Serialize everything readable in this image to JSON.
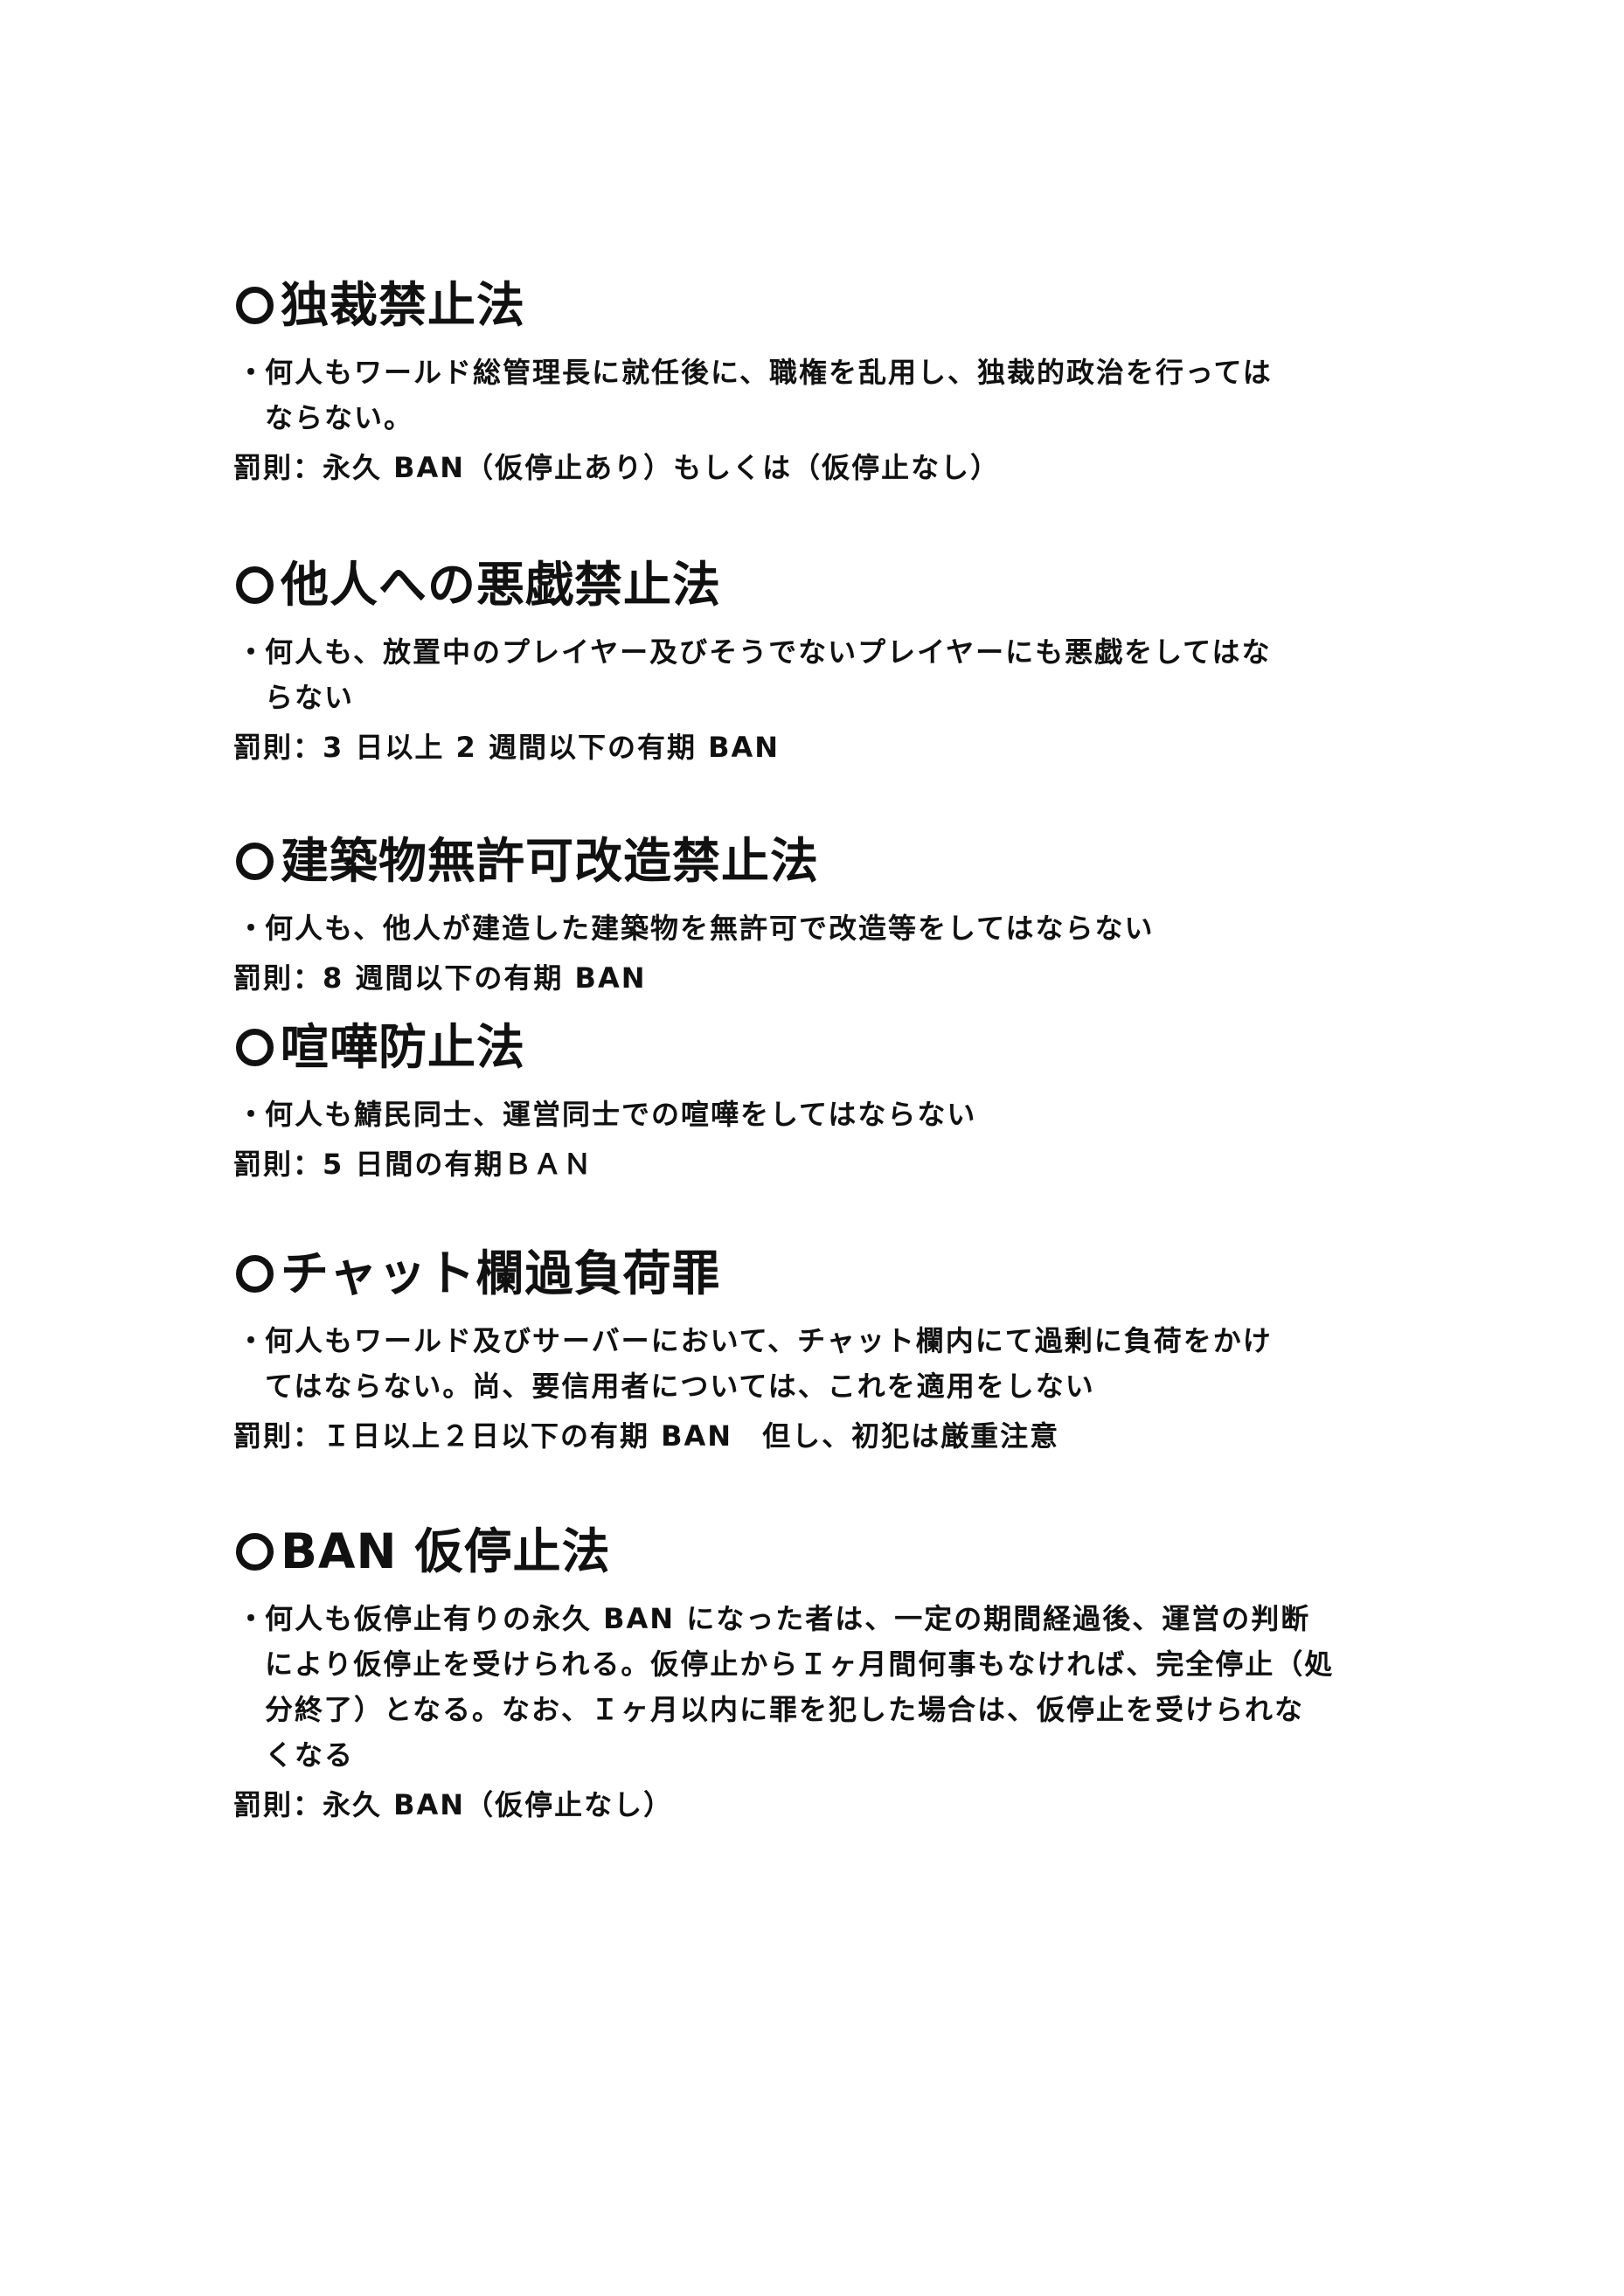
{
  "sections": [
    {
      "title": "独裁禁止法",
      "bullet": "・",
      "lines": [
        "何人もワールド総管理長に就任後に、職権を乱用し、独裁的政治を行っては",
        "ならない。"
      ],
      "penalty": "罰則：永久 BAN（仮停止あり）もしくは（仮停止なし）"
    },
    {
      "title": "他人への悪戯禁止法",
      "bullet": "・",
      "lines": [
        "何人も、放置中のプレイヤー及びそうでないプレイヤーにも悪戯をしてはな",
        "らない"
      ],
      "penalty": "罰則：3 日以上 2 週間以下の有期 BAN"
    },
    {
      "title": "建築物無許可改造禁止法",
      "bullet": "・",
      "lines": [
        "何人も、他人が建造した建築物を無許可で改造等をしてはならない"
      ],
      "penalty": "罰則：8 週間以下の有期 BAN"
    },
    {
      "title": "喧嘩防止法",
      "bullet": "・",
      "lines": [
        "何人も鯖民同士、運営同士での喧嘩をしてはならない"
      ],
      "penalty": "罰則：5 日間の有期ＢＡＮ"
    },
    {
      "title": "チャット欄過負荷罪",
      "bullet": "・",
      "lines": [
        "何人もワールド及びサーバーにおいて、チャット欄内にて過剰に負荷をかけ",
        "てはならない。尚、要信用者については、これを適用をしない"
      ],
      "penalty": "罰則：Ｉ日以上２日以下の有期 BAN　但し、初犯は厳重注意"
    },
    {
      "title": "BAN 仮停止法",
      "bullet": "・",
      "lines": [
        "何人も仮停止有りの永久 BAN になった者は、一定の期間経過後、運営の判断",
        "により仮停止を受けられる。仮停止からＩヶ月間何事もなければ、完全停止（処",
        "分終了）となる。なお、Ｉヶ月以内に罪を犯した場合は、仮停止を受けられな",
        "くなる"
      ],
      "penalty": "罰則：永久 BAN（仮停止なし）"
    }
  ]
}
